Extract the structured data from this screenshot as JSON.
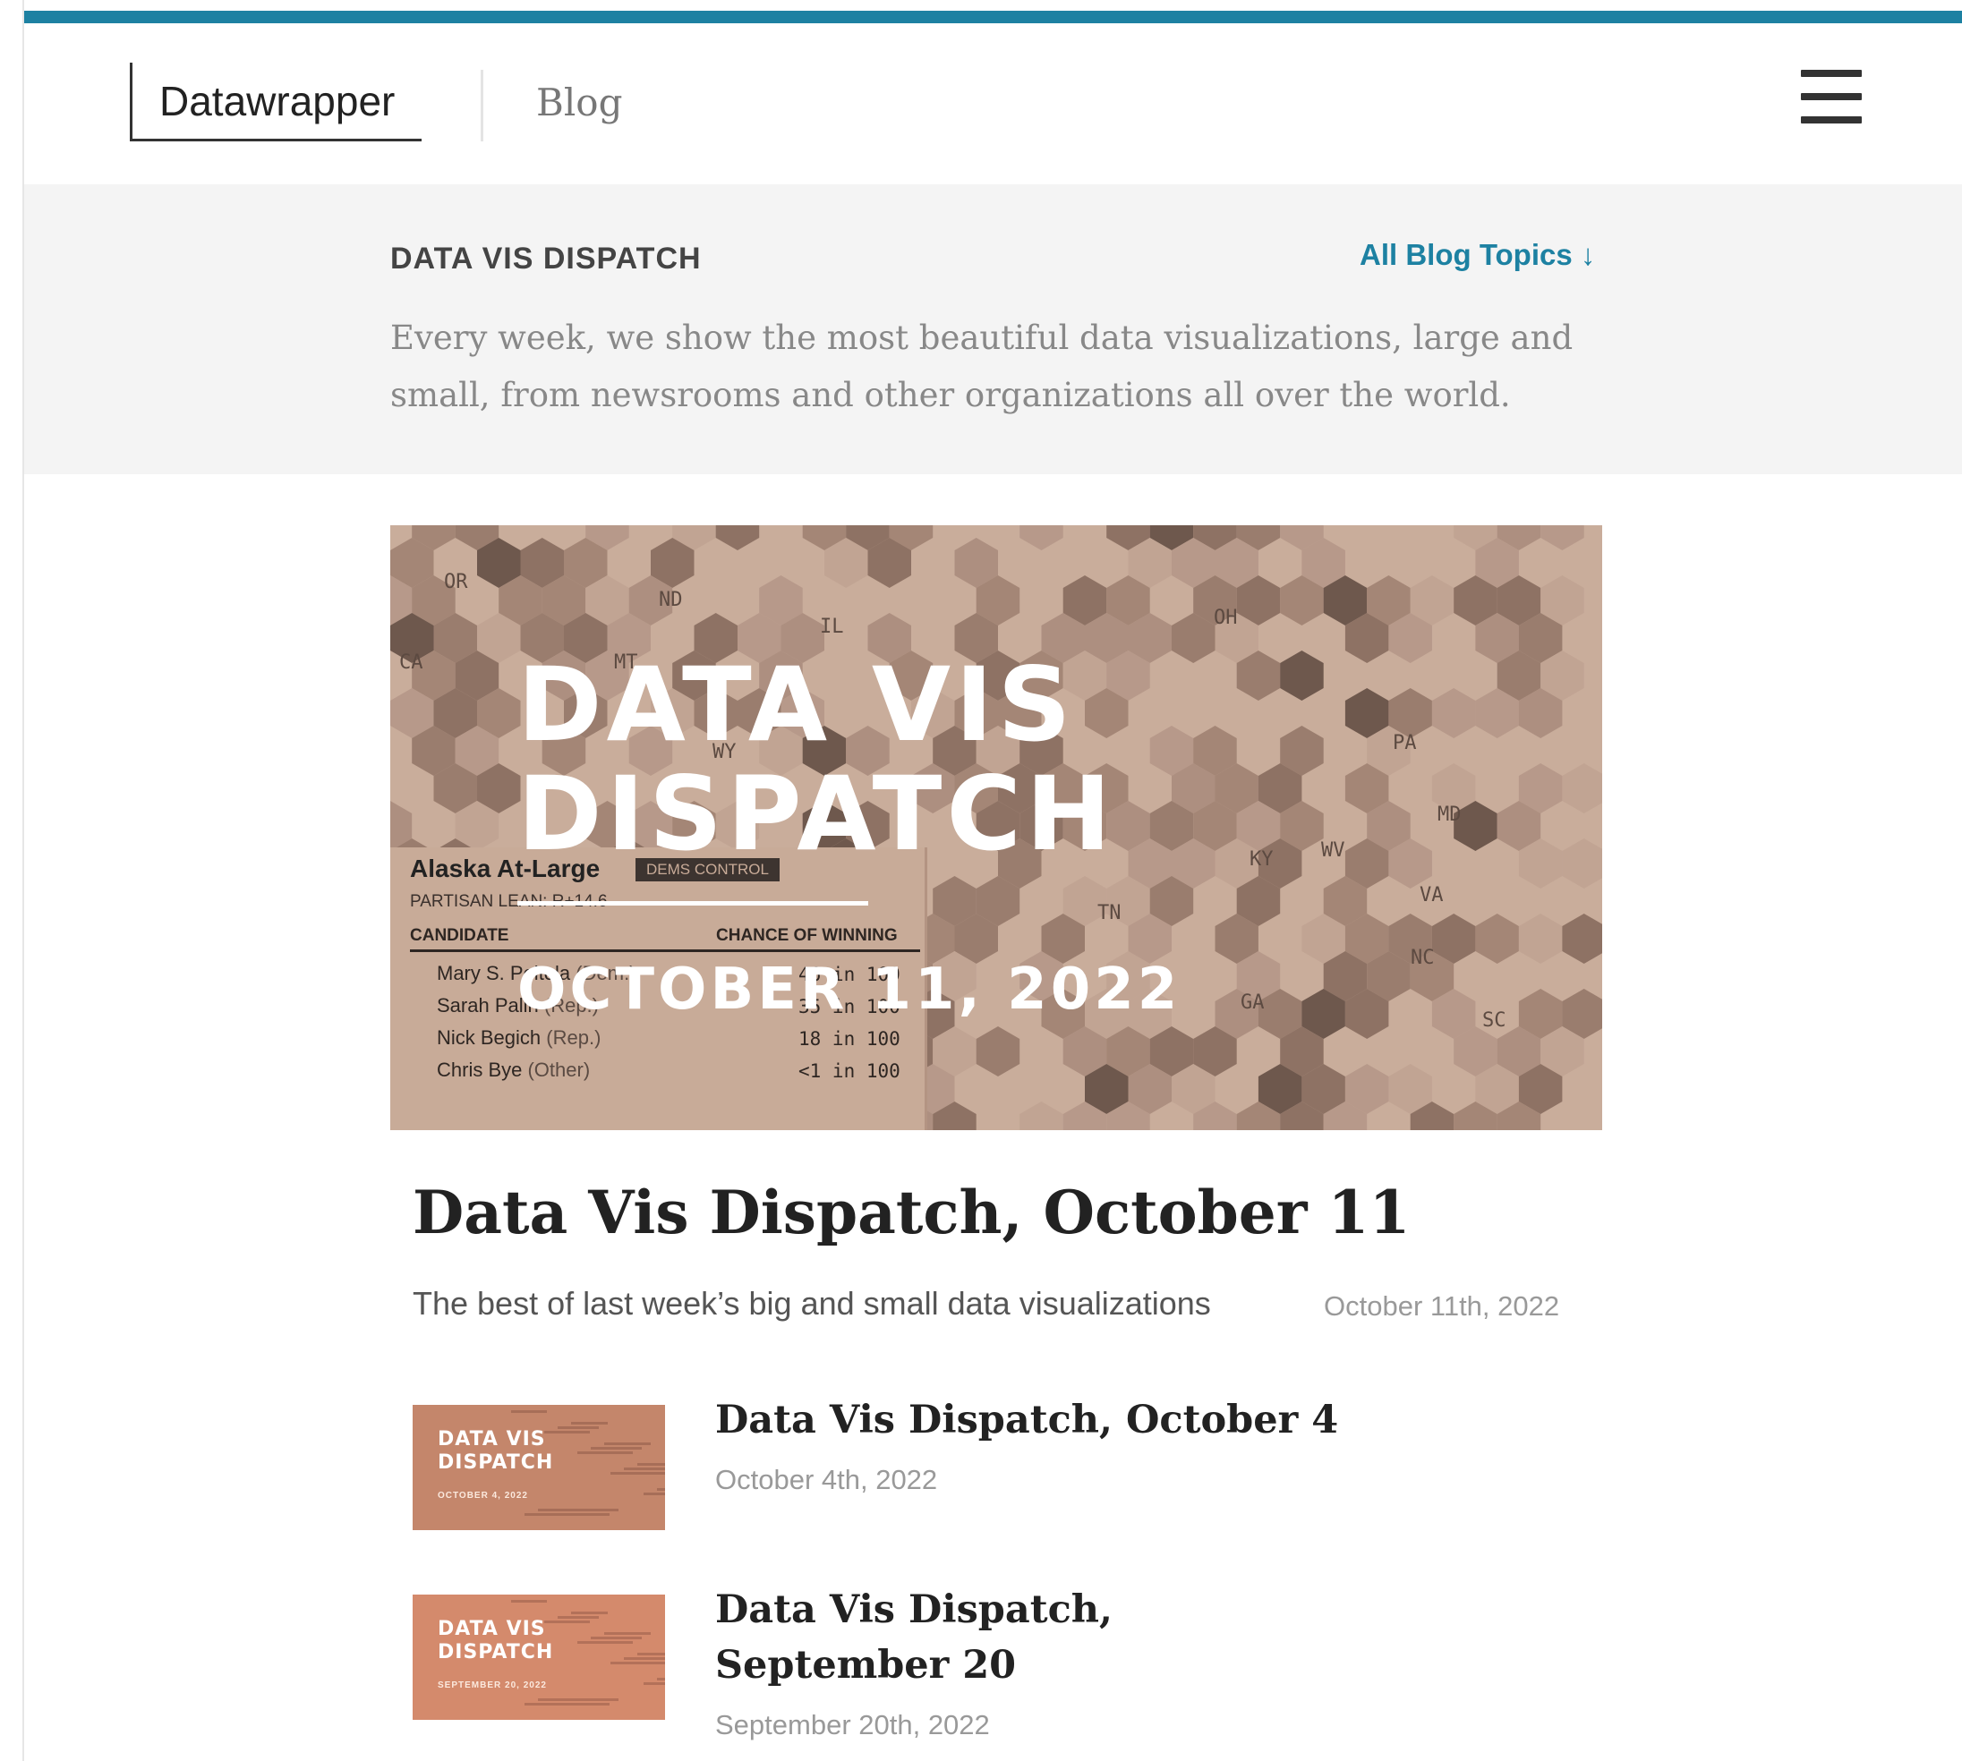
{
  "header": {
    "logo": "Datawrapper",
    "nav_blog": "Blog",
    "menu_icon": "hamburger-menu-icon"
  },
  "topic": {
    "title": "DATA VIS DISPATCH",
    "link": "All Blog Topics ↓",
    "description": "Every week, we show the most beautiful data visualizations, large and small, from newsrooms and other organizations all over the world."
  },
  "hero": {
    "title_line1": "DATA VIS",
    "title_line2": "DISPATCH",
    "date": "OCTOBER 11, 2022",
    "map_labels": [
      "OR",
      "ND",
      "IL",
      "OH",
      "MT",
      "WY",
      "PA",
      "MD",
      "KY",
      "WV",
      "VA",
      "TN",
      "NC",
      "GA",
      "SC",
      "CA"
    ],
    "card": {
      "name": "Alaska At-Large",
      "badge": "DEMS CONTROL",
      "lean": "PARTISAN LEAN: R+14.6",
      "col_candidate": "CANDIDATE",
      "col_chance": "CHANCE OF WINNING",
      "rows": [
        {
          "name": "Mary S. Peltola",
          "party": "(Dem.)",
          "value": "46 in 100"
        },
        {
          "name": "Sarah Palin",
          "party": "(Rep.)",
          "value": "35 in 100"
        },
        {
          "name": "Nick Begich",
          "party": "(Rep.)",
          "value": "18 in 100"
        },
        {
          "name": "Chris Bye",
          "party": "(Other)",
          "value": "<1 in 100"
        }
      ]
    }
  },
  "featured": {
    "title": "Data Vis Dispatch, October 11",
    "subtitle": "The best of last week’s big and small data visualizations",
    "date": "October 11th, 2022"
  },
  "related": [
    {
      "title": "Data Vis Dispatch, October 4",
      "date": "October 4th, 2022",
      "thumb_title1": "DATA VIS",
      "thumb_title2": "DISPATCH",
      "thumb_date": "OCTOBER 4, 2022",
      "thumb_color": "#c4866b"
    },
    {
      "title_line1": "Data Vis Dispatch,",
      "title_line2": "September 20",
      "date": "September 20th, 2022",
      "thumb_title1": "DATA VIS",
      "thumb_title2": "DISPATCH",
      "thumb_date": "SEPTEMBER 20, 2022",
      "thumb_color": "#d48a6c"
    }
  ],
  "colors": {
    "accent": "#1d81a2",
    "hero_bg": "#c9ad9b",
    "band_bg": "#f4f4f4"
  }
}
